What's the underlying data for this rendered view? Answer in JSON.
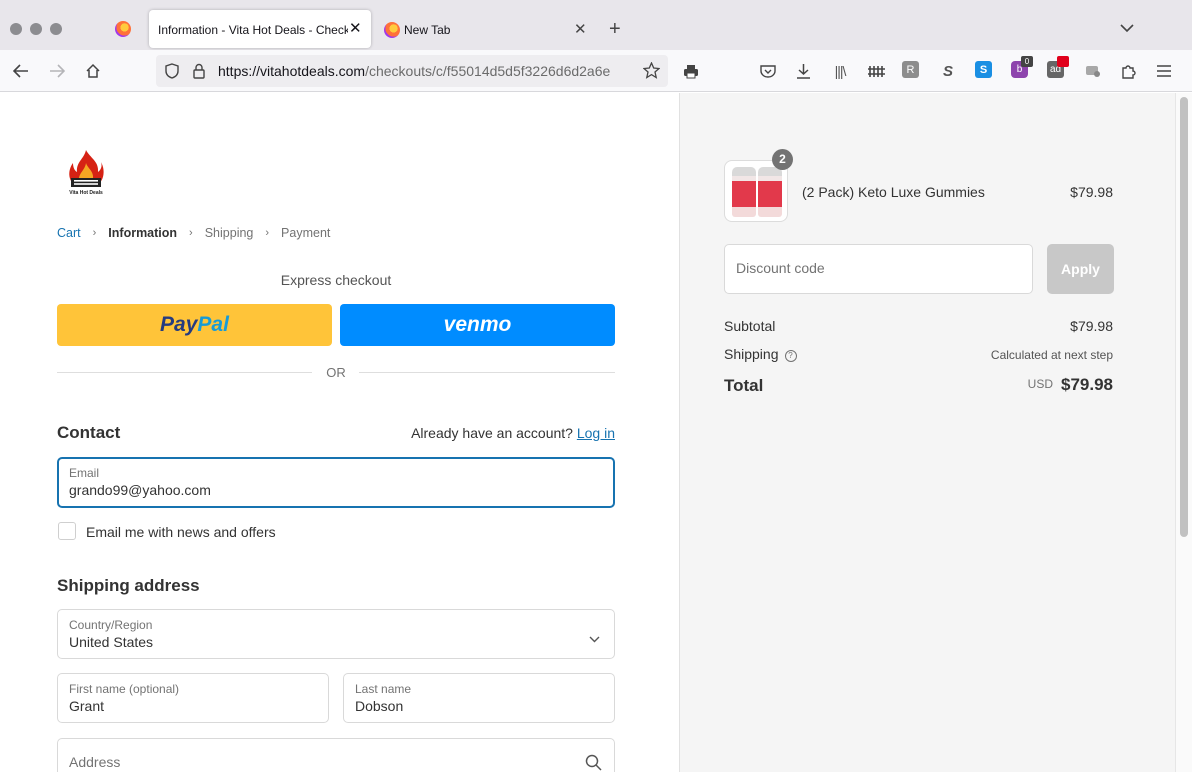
{
  "browser": {
    "tabs": [
      {
        "title": "Information - Vita Hot Deals - Checkout",
        "active": true
      },
      {
        "title": "New Tab",
        "active": false
      }
    ],
    "url_domain": "https://vitahotdeals.com",
    "url_path": "/checkouts/c/f55014d5d5f3226d6d2a6e",
    "extension_badges": [
      "0"
    ]
  },
  "store": {
    "logo_text": "Vita Hot Deals"
  },
  "breadcrumb": {
    "cart": "Cart",
    "information": "Information",
    "shipping": "Shipping",
    "payment": "Payment"
  },
  "express": {
    "label": "Express checkout",
    "paypal_pay": "Pay",
    "paypal_pal": "Pal",
    "venmo": "venmo",
    "or": "OR"
  },
  "contact": {
    "title": "Contact",
    "account_prompt": "Already have an account?",
    "login_link": "Log in",
    "email_label": "Email",
    "email_value": "grando99@yahoo.com",
    "newsletter_label": "Email me with news and offers"
  },
  "shipping": {
    "title": "Shipping address",
    "country_label": "Country/Region",
    "country_value": "United States",
    "first_name_label": "First name (optional)",
    "first_name_value": "Grant",
    "last_name_label": "Last name",
    "last_name_value": "Dobson",
    "address_placeholder": "Address"
  },
  "summary": {
    "item_qty": "2",
    "item_name": "(2 Pack) Keto Luxe Gummies",
    "item_price": "$79.98",
    "discount_placeholder": "Discount code",
    "apply_label": "Apply",
    "subtotal_label": "Subtotal",
    "subtotal_value": "$79.98",
    "shipping_label": "Shipping",
    "shipping_value": "Calculated at next step",
    "total_label": "Total",
    "currency": "USD",
    "total_value": "$79.98"
  },
  "colors": {
    "link": "#1773b0",
    "paypal": "#ffc439",
    "venmo": "#008cff",
    "focus_border": "#1773b0"
  }
}
